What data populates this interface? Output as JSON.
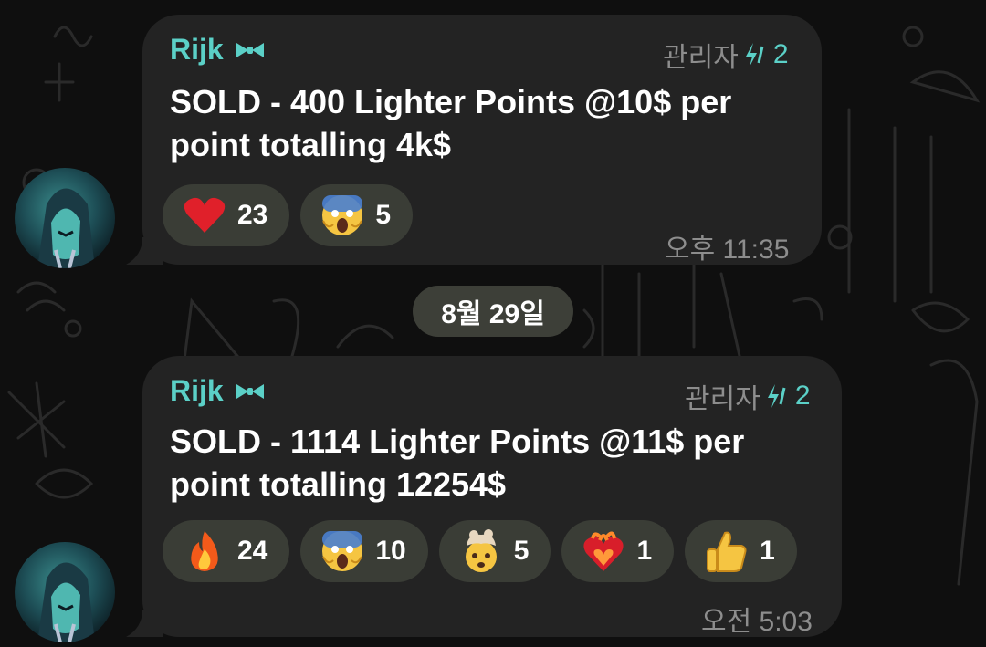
{
  "messages": [
    {
      "sender": "Rijk",
      "sender_badge_icon": "bow-tie-icon",
      "role": "관리자",
      "boost_count": "2",
      "text_line1": "SOLD - 400 Lighter Points @10$ per",
      "text_line2": "point totalling 4k$",
      "reactions": [
        {
          "emoji": "red-heart-icon",
          "count": "23"
        },
        {
          "emoji": "screaming-face-icon",
          "count": "5"
        }
      ],
      "time": "오후 11:35"
    },
    {
      "sender": "Rijk",
      "sender_badge_icon": "bow-tie-icon",
      "role": "관리자",
      "boost_count": "2",
      "text_line1": "SOLD - 1114 Lighter Points @11$ per",
      "text_line2": "point totalling 12254$",
      "reactions": [
        {
          "emoji": "fire-icon",
          "count": "24"
        },
        {
          "emoji": "screaming-face-icon",
          "count": "10"
        },
        {
          "emoji": "exploding-head-icon",
          "count": "5"
        },
        {
          "emoji": "heart-on-fire-icon",
          "count": "1"
        },
        {
          "emoji": "thumbs-up-icon",
          "count": "1"
        }
      ],
      "time": "오전 5:03"
    }
  ],
  "date_separator": "8월 29일",
  "colors": {
    "bubble": "#232323",
    "sender_name": "#5bd0c7",
    "reaction_pill": "#3a3d36",
    "meta_text": "#8d8d8d"
  }
}
